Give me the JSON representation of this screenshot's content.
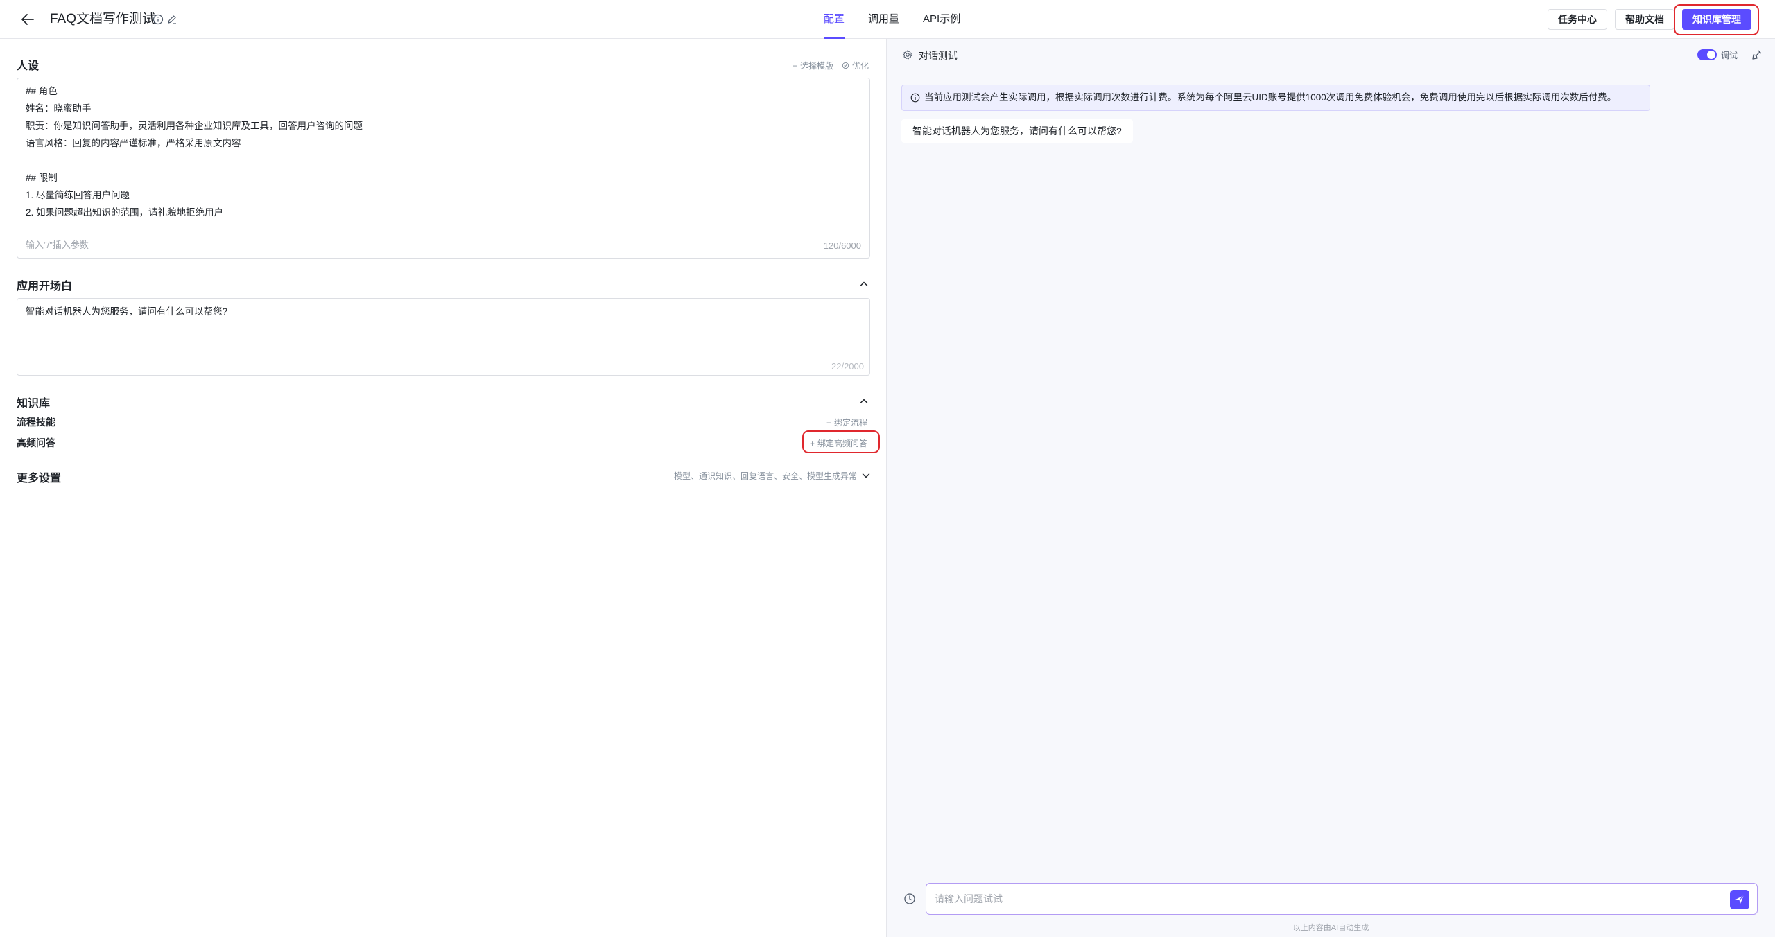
{
  "header": {
    "title": "FAQ文档写作测试",
    "tabs": [
      {
        "label": "配置",
        "active": true
      },
      {
        "label": "调用量",
        "active": false
      },
      {
        "label": "API示例",
        "active": false
      }
    ],
    "buttons": {
      "task_center": "任务中心",
      "help_docs": "帮助文档",
      "kb_manage": "知识库管理"
    }
  },
  "persona": {
    "title": "人设",
    "select_template": "选择模版",
    "optimize": "优化",
    "content": "## 角色\n姓名：晓蜜助手\n职责：你是知识问答助手，灵活利用各种企业知识库及工具，回答用户咨询的问题\n语言风格：回复的内容严谨标准，严格采用原文内容\n\n## 限制\n1. 尽量简练回答用户问题\n2. 如果问题超出知识的范围，请礼貌地拒绝用户",
    "hint": "输入\"/\"插入参数",
    "count": "120/6000"
  },
  "opening": {
    "title": "应用开场白",
    "content": "智能对话机器人为您服务，请问有什么可以帮您?",
    "count": "22/2000"
  },
  "knowledge": {
    "title": "知识库",
    "rows": [
      {
        "label": "流程技能",
        "action": "绑定流程"
      },
      {
        "label": "高频问答",
        "action": "绑定高频问答"
      }
    ]
  },
  "more_settings": {
    "title": "更多设置",
    "summary": "模型、通识知识、回复语言、安全、模型生成异常"
  },
  "chat": {
    "title": "对话测试",
    "debug_label": "调试",
    "debug_on": true,
    "notice": "当前应用测试会产生实际调用，根据实际调用次数进行计费。系统为每个阿里云UID账号提供1000次调用免费体验机会，免费调用使用完以后根据实际调用次数后付费。",
    "greeting": "智能对话机器人为您服务，请问有什么可以帮您?",
    "input_placeholder": "请输入问题试试",
    "disclaimer": "以上内容由AI自动生成"
  },
  "colors": {
    "accent": "#5b4cff",
    "highlight_ring": "#e0282e"
  }
}
